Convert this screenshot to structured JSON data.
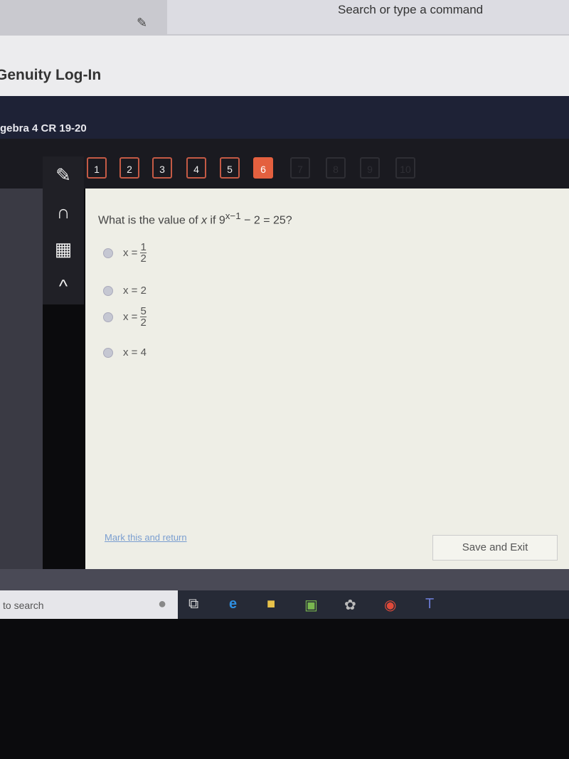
{
  "browser": {
    "command_placeholder": "Search or type a command"
  },
  "tab": {
    "title": "Genuity Log-In"
  },
  "course": {
    "title": "gebra 4 CR 19-20"
  },
  "questions": {
    "numbers": [
      "1",
      "2",
      "3",
      "4",
      "5",
      "6",
      "7",
      "8",
      "9",
      "10"
    ],
    "active": "6",
    "accent": "#e4603f"
  },
  "tools": [
    "pencil-icon",
    "headphones-icon",
    "calculator-icon",
    "collapse-up-icon"
  ],
  "main": {
    "question_prefix": "What is the value of ",
    "question_var": "x",
    "question_mid": " if ",
    "base": "9",
    "exponent": "x−1",
    "question_suffix": " − 2 = 25?",
    "options": [
      {
        "lhs": "x =",
        "num": "1",
        "den": "2"
      },
      {
        "lhs": "x = 2"
      },
      {
        "lhs": "x =",
        "num": "5",
        "den": "2"
      },
      {
        "lhs": "x = 4"
      }
    ],
    "mark_link": "Mark this and return",
    "save_button": "Save and Exit"
  },
  "taskbar": {
    "search_text": "to search"
  }
}
